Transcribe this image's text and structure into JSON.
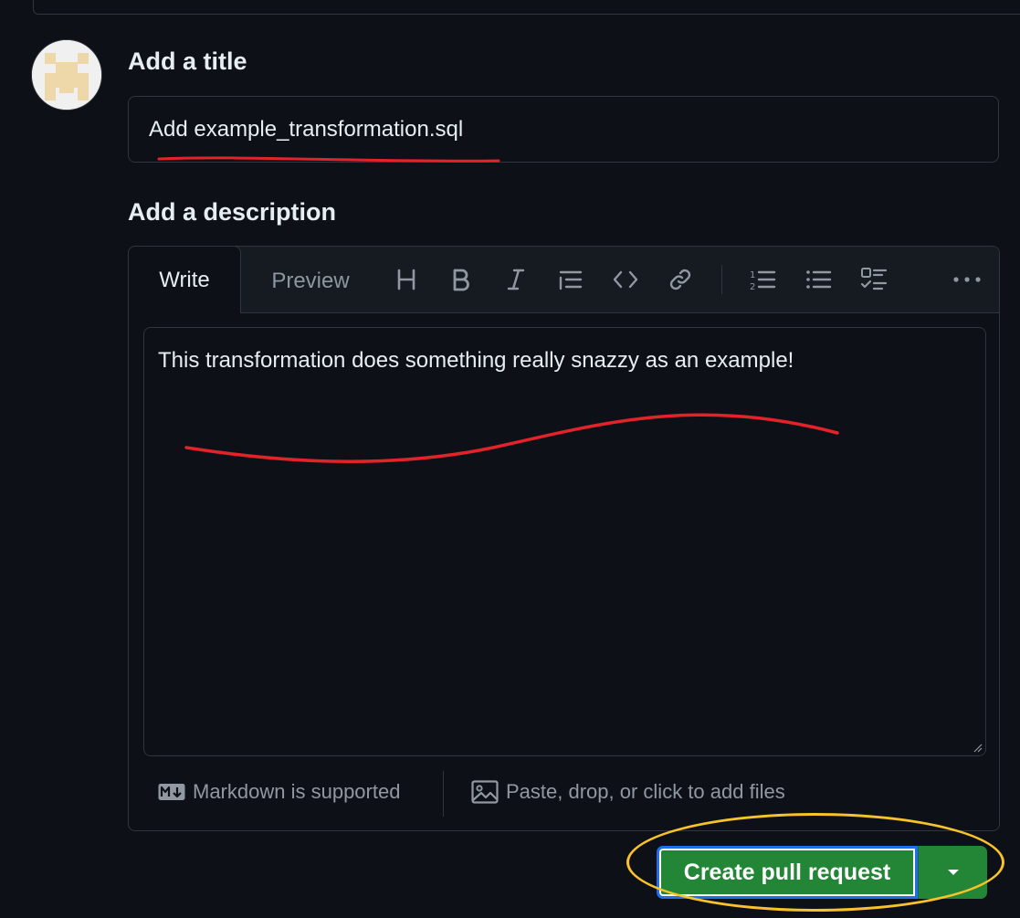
{
  "form": {
    "title_heading": "Add a title",
    "title_value": "Add example_transformation.sql",
    "description_heading": "Add a description"
  },
  "editor": {
    "tabs": {
      "write": "Write",
      "preview": "Preview"
    },
    "toolbar_icons": [
      "heading-icon",
      "bold-icon",
      "italic-icon",
      "quote-icon",
      "code-icon",
      "link-icon",
      "numbered-list-icon",
      "unordered-list-icon",
      "task-list-icon",
      "more-options-icon"
    ],
    "body_text": "This transformation does something really snazzy as an example!",
    "footer": {
      "markdown_note": "Markdown is supported",
      "attach_note": "Paste, drop, or click to add files"
    }
  },
  "actions": {
    "create_pr_label": "Create pull request"
  },
  "colors": {
    "background": "#0d1117",
    "border": "#30363d",
    "primary_button": "#238636",
    "focus_ring": "#1f6feb",
    "annotation_red": "#e3222a",
    "annotation_yellow": "#f8c22a"
  }
}
